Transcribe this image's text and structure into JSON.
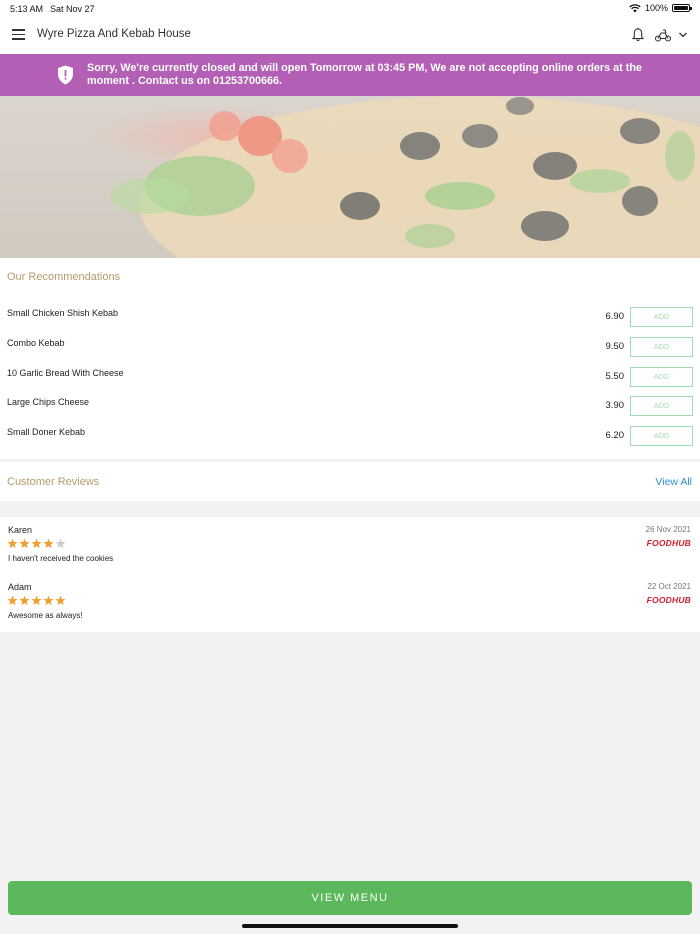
{
  "status_bar": {
    "time": "5:13 AM",
    "date": "Sat Nov 27",
    "battery": "100%"
  },
  "header": {
    "title": "Wyre Pizza And Kebab House"
  },
  "banner": {
    "message": "Sorry, We're currently closed and will open Tomorrow at 03:45 PM, We are not accepting online orders at the moment . Contact us on  01253700666.",
    "color": "#b25fb5"
  },
  "recommendations": {
    "title": "Our Recommendations",
    "add_label": "ADD",
    "items": [
      {
        "name": "Small Chicken Shish Kebab",
        "price": "6.90"
      },
      {
        "name": "Combo Kebab",
        "price": "9.50"
      },
      {
        "name": "10 Garlic Bread With Cheese",
        "price": "5.50"
      },
      {
        "name": "Large Chips Cheese",
        "price": "3.90"
      },
      {
        "name": "Small Doner Kebab",
        "price": "6.20"
      }
    ]
  },
  "reviews": {
    "title": "Customer Reviews",
    "view_all": "View All",
    "items": [
      {
        "author": "Karen",
        "date": "26 Nov 2021",
        "rating": 4,
        "comment": "I haven't received the cookies",
        "source": "FOODHUB"
      },
      {
        "author": "Adam",
        "date": "22 Oct 2021",
        "rating": 5,
        "comment": "Awesome as always!",
        "source": "FOODHUB"
      }
    ]
  },
  "footer": {
    "view_menu": "VIEW MENU",
    "button_color": "#5cb85c"
  },
  "colors": {
    "star_filled": "#f0a030",
    "star_empty": "#cccccc",
    "section_title": "#b59b6d",
    "link": "#2a8fd0"
  }
}
